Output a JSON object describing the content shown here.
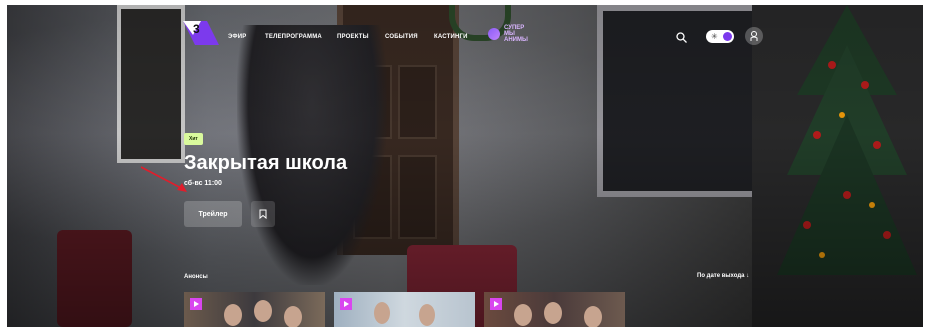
{
  "header": {
    "logo_text": "3",
    "nav": [
      "ЭФИР",
      "ТЕЛЕПРОГРАММА",
      "ПРОЕКТЫ",
      "СОБЫТИЯ",
      "КАСТИНГИ"
    ],
    "special_nav": "СУПЕР МЫ АНИМЫ",
    "icons": [
      "search-icon",
      "sun-icon",
      "moon-icon",
      "user-icon"
    ]
  },
  "hero": {
    "badge": "Хит",
    "title": "Закрытая школа",
    "schedule": "сб-вс 11:00",
    "trailer_label": "Трейлер"
  },
  "announcements": {
    "label": "Анонсы",
    "sort_label": "По дате выхода",
    "sort_arrow": "↓"
  },
  "colors": {
    "accent": "#7c3aed",
    "badge": "#d9f99d",
    "play": "#d946ef",
    "arrow": "#e11d2b"
  }
}
